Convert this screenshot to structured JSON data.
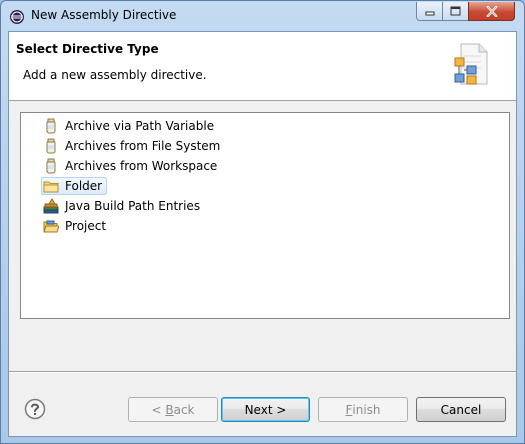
{
  "window": {
    "title": "New Assembly Directive",
    "controls": {
      "minimize": "minimize",
      "maximize": "maximize",
      "close": "close"
    }
  },
  "header": {
    "title": "Select Directive Type",
    "description": "Add a new assembly directive."
  },
  "tree": {
    "items": [
      {
        "label": "Archive via Path Variable",
        "icon": "jar-icon",
        "selected": false
      },
      {
        "label": "Archives from File System",
        "icon": "jar-icon",
        "selected": false
      },
      {
        "label": "Archives from Workspace",
        "icon": "jar-icon",
        "selected": false
      },
      {
        "label": "Folder",
        "icon": "folder-icon",
        "selected": true
      },
      {
        "label": "Java Build Path Entries",
        "icon": "library-icon",
        "selected": false
      },
      {
        "label": "Project",
        "icon": "project-folder-icon",
        "selected": false
      }
    ]
  },
  "buttons": {
    "back_prefix": "< ",
    "back_mnemonic": "B",
    "back_rest": "ack",
    "next": "Next >",
    "finish_mnemonic": "F",
    "finish_rest": "inish",
    "cancel": "Cancel"
  },
  "colors": {
    "titlebar": "#c3daf2",
    "close_button": "#c94a33",
    "selection": "#dcebfc",
    "default_button_border": "#3c7fb1"
  }
}
